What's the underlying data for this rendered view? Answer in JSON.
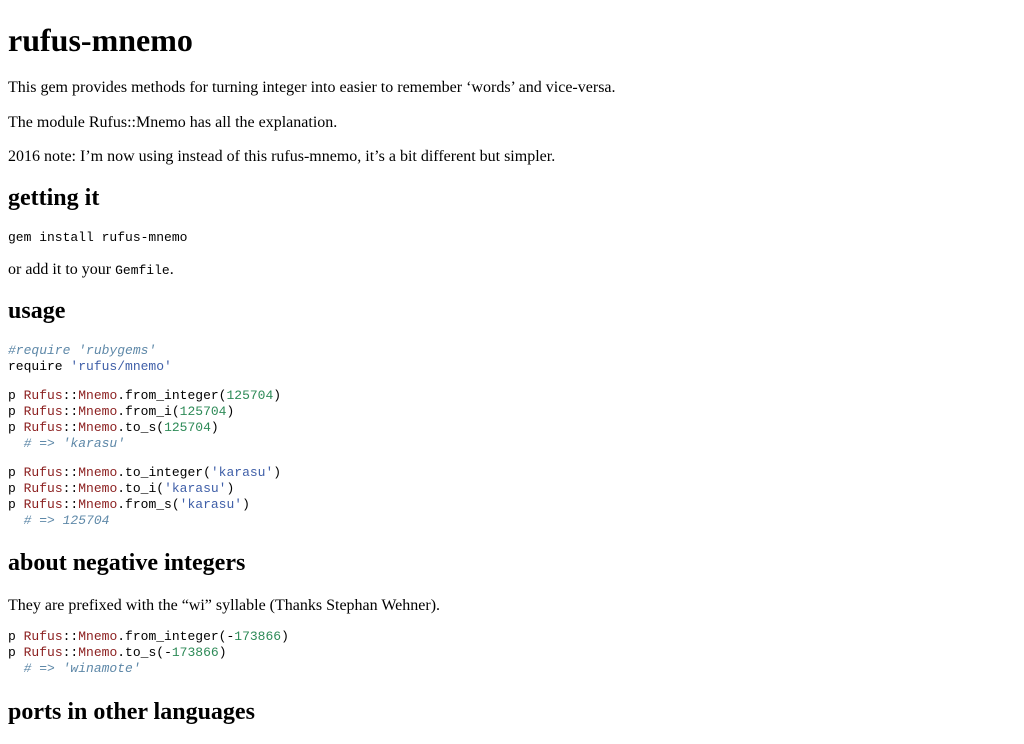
{
  "title": "rufus-mnemo",
  "intro": "This gem provides methods for turning integer into easier to remember ‘words’ and vice-versa.",
  "module_note": "The module Rufus::Mnemo has all the explanation.",
  "note_2016": "2016 note: I’m now using instead of this rufus-mnemo, it’s a bit different but simpler.",
  "getting_it": {
    "heading": "getting it",
    "command": "gem install rufus-mnemo",
    "or_add_prefix": "or add it to your ",
    "gemfile": "Gemfile",
    "or_add_suffix": "."
  },
  "usage": {
    "heading": "usage",
    "require_comment": "#require 'rubygems'",
    "require_kw": "require ",
    "require_str": "'rufus/mnemo'",
    "p": "p ",
    "rufus": "Rufus",
    "sep": "::",
    "mnemo": "Mnemo",
    "m_from_integer": ".from_integer(",
    "m_from_i": ".from_i(",
    "m_to_s": ".to_s(",
    "m_to_integer": ".to_integer(",
    "m_to_i": ".to_i(",
    "m_from_s": ".from_s(",
    "close": ")",
    "num": "125704",
    "word": "'karasu'",
    "result1": "# => 'karasu'",
    "result2": "# => 125704"
  },
  "negative": {
    "heading": "about negative integers",
    "text": "They are prefixed with the “wi” syllable (Thanks Stephan Wehner).",
    "minus": "-",
    "num": "173866",
    "result": "# => 'winamote'"
  },
  "ports": {
    "heading": "ports in other languages"
  }
}
